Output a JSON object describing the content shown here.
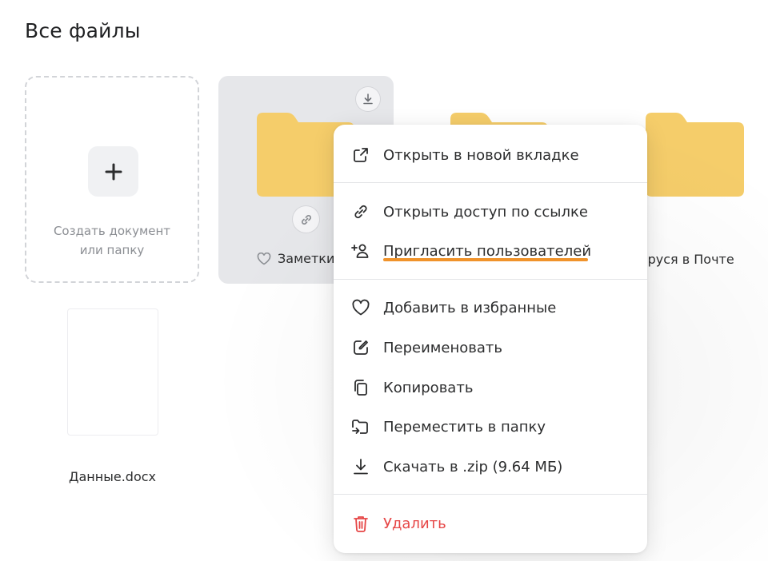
{
  "header": {
    "title": "Все файлы"
  },
  "create_tile": {
    "label": "Создать документ или папку"
  },
  "folders": [
    {
      "name": "Заметки",
      "favorite_icon": "heart-icon"
    },
    {
      "name": ""
    },
    {
      "name": "Маруся в Почте"
    }
  ],
  "documents": [
    {
      "name": "Данные.docx"
    }
  ],
  "context_menu": {
    "open_new_tab": "Открыть в новой вкладке",
    "share_link": "Открыть доступ по ссылке",
    "invite_users": "Пригласить пользователей",
    "add_favorites": "Добавить в избранные",
    "rename": "Переименовать",
    "copy": "Копировать",
    "move": "Переместить в папку",
    "download_zip": "Скачать в .zip (9.64 МБ)",
    "delete": "Удалить"
  },
  "colors": {
    "folder": "#f5cd6a",
    "danger": "#e64646",
    "highlight_underline": "#f0932b"
  }
}
